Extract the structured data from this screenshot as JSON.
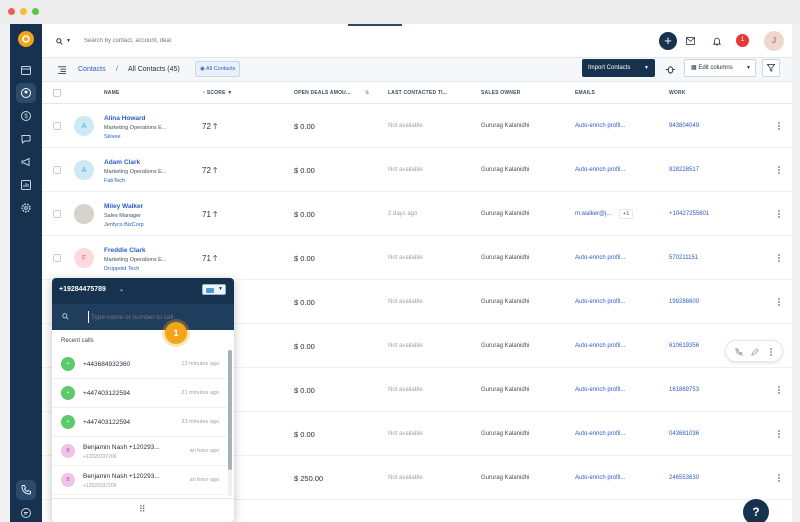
{
  "window": {
    "dots": [
      "#ee5f58",
      "#f6bd3a",
      "#5bc544"
    ]
  },
  "nav": {
    "items": [
      "logo",
      "calendar-icon",
      "contacts-icon",
      "deals-icon",
      "chat-icon",
      "campaigns-icon",
      "reports-icon",
      "settings-icon"
    ]
  },
  "topbar": {
    "search_placeholder": "Search by contact, account, deal",
    "notification_count": "1",
    "avatar_initial": "J"
  },
  "subbar": {
    "crumb_contacts": "Contacts",
    "view_title": "All Contacts (45)",
    "all_contacts_tag": "All Contacts",
    "import_label": "Import Contacts",
    "edit_columns_label": "Edit columns"
  },
  "table": {
    "columns": {
      "name": "NAME",
      "score": "SCORE",
      "deals": "OPEN DEALS AMOU...",
      "last_contacted": "LAST CONTACTED TI...",
      "owner": "SALES OWNER",
      "emails": "EMAILS",
      "work": "WORK"
    },
    "rows": [
      {
        "name": "Alina Howard",
        "title": "Marketing Operations E...",
        "company": "Skivee",
        "initial": "A",
        "score": "72",
        "deals": "$ 0.00",
        "last": "Not available",
        "owner": "Gururag Kalanidhi",
        "email": "Auto-enrich profil...",
        "work": "943804049"
      },
      {
        "name": "Adam Clark",
        "title": "Marketing Operations E...",
        "company": "FabTech",
        "initial": "A",
        "score": "72",
        "deals": "$ 0.00",
        "last": "Not available",
        "owner": "Gururag Kalanidhi",
        "email": "Auto-enrich profil...",
        "work": "928228517"
      },
      {
        "name": "Miley Walker",
        "title": "Sales Manager",
        "company": "Jenfycs BizCorp",
        "initial": "",
        "score": "71",
        "deals": "$ 0.00",
        "last": "2 days ago",
        "owner": "Gururag Kalanidhi",
        "email": "m.walker@j...",
        "email_extra": "+1",
        "work": "+10427255601"
      },
      {
        "name": "Freddie Clark",
        "title": "Marketing Operations E...",
        "company": "Druppoid Tech",
        "initial": "F",
        "score": "71",
        "deals": "$ 0.00",
        "last": "Not available",
        "owner": "Gururag Kalanidhi",
        "email": "Auto-enrich profil...",
        "work": "570211151"
      },
      {
        "name": "",
        "title": "",
        "company": "",
        "initial": "",
        "score": "",
        "deals": "$ 0.00",
        "last": "Not available",
        "owner": "Gururag Kalanidhi",
        "email": "Auto-enrich profil...",
        "work": "199288600"
      },
      {
        "name": "",
        "title": "",
        "company": "",
        "initial": "",
        "score": "",
        "deals": "$ 0.00",
        "last": "Not available",
        "owner": "Gururag Kalanidhi",
        "email": "Auto-enrich profil...",
        "work": "610619356"
      },
      {
        "name": "",
        "title": "",
        "company": "",
        "initial": "",
        "score": "",
        "deals": "$ 0.00",
        "last": "Not available",
        "owner": "Gururag Kalanidhi",
        "email": "Auto-enrich profil...",
        "work": "161869753"
      },
      {
        "name": "",
        "title": "",
        "company": "",
        "initial": "",
        "score": "",
        "deals": "$ 0.00",
        "last": "Not available",
        "owner": "Gururag Kalanidhi",
        "email": "Auto-enrich profil...",
        "work": "043681036"
      },
      {
        "name": "",
        "title": "",
        "company": "",
        "initial": "",
        "score": "",
        "deals": "$ 250.00",
        "last": "Not available",
        "owner": "Gururag Kalanidhi",
        "email": "Auto-enrich profil...",
        "work": "246553630"
      }
    ]
  },
  "dialer": {
    "number": "+19284475789",
    "search_placeholder": "Type name or number to call",
    "step_badge": "1",
    "recent_label": "Recent calls",
    "calls": [
      {
        "name": "+443684932360",
        "sub": "",
        "time": "13 minutes ago",
        "initial": "+"
      },
      {
        "name": "+447403122594",
        "sub": "",
        "time": "21 minutes ago",
        "initial": "+"
      },
      {
        "name": "+447403122594",
        "sub": "",
        "time": "33 minutes ago",
        "initial": "+"
      },
      {
        "name": "Benjamin Nash +120293...",
        "sub": "+12029337206",
        "time": "an hour ago",
        "initial": "B"
      },
      {
        "name": "Benjamin Nash +120293...",
        "sub": "+12029337206",
        "time": "an hour ago",
        "initial": "B"
      }
    ]
  },
  "help_label": "?"
}
